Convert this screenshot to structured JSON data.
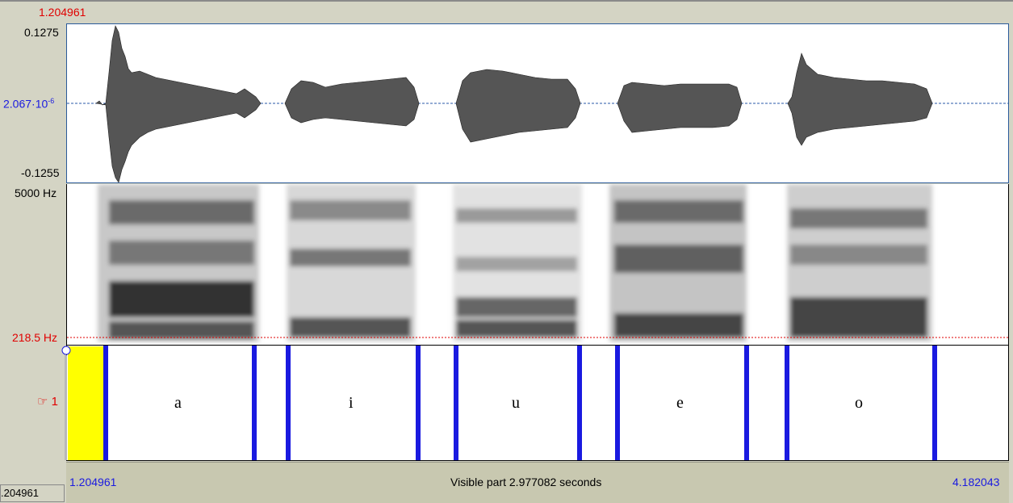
{
  "cursor_time": "1.204961",
  "waveform": {
    "max_label": "0.1275",
    "mid_label": "2.067·10",
    "mid_exp": "-6",
    "min_label": "-0.1255"
  },
  "spectrogram": {
    "max_label": "5000 Hz",
    "min_label": "218.5 Hz"
  },
  "tier": {
    "number_label": "☞ 1",
    "intervals": [
      {
        "text": "a"
      },
      {
        "text": "i"
      },
      {
        "text": "u"
      },
      {
        "text": "e"
      },
      {
        "text": "o"
      }
    ]
  },
  "bottom": {
    "left_time": "1.204961",
    "visible_part": "Visible part 2.977082 seconds",
    "right_time": "4.182043",
    "left_box": ".204961"
  },
  "colors": {
    "boundary": "#1a1ae0",
    "selection": "#ffff00",
    "cursor": "#e00000"
  }
}
